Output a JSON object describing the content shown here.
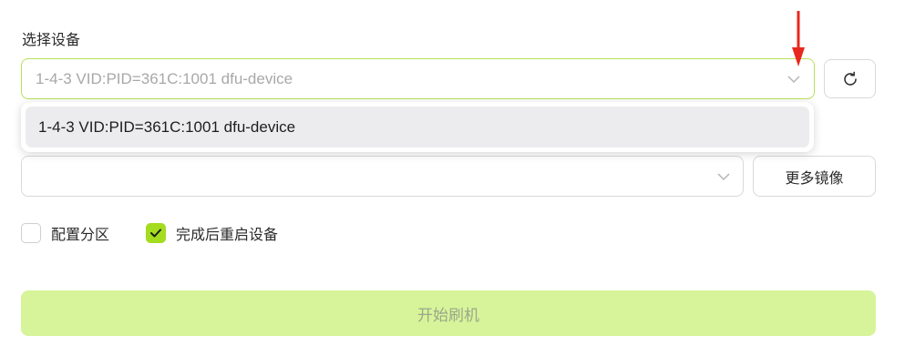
{
  "form": {
    "device_label": "选择设备",
    "device_value": "1-4-3 VID:PID=361C:1001 dfu-device",
    "dropdown_options": [
      "1-4-3 VID:PID=361C:1001 dfu-device"
    ],
    "image_value": "",
    "more_images_label": "更多镜像",
    "checkboxes": [
      {
        "label": "配置分区",
        "checked": false
      },
      {
        "label": "完成后重启设备",
        "checked": true
      }
    ],
    "start_label": "开始刷机"
  },
  "icons": {
    "refresh": "refresh-icon",
    "chevron": "chevron-down-icon",
    "check": "check-icon"
  },
  "colors": {
    "accent": "#a4dc1f",
    "focus_border": "#b7e05a",
    "start_button_bg": "#d8f49a",
    "annotation_arrow": "#e8281e"
  }
}
